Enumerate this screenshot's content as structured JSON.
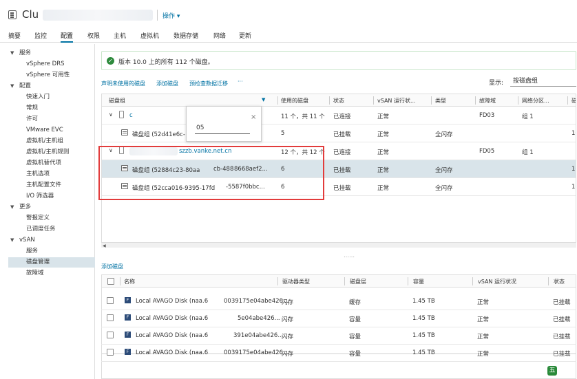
{
  "header": {
    "title": "Clu",
    "actions_label": "操作 ▾"
  },
  "tabs": [
    "摘要",
    "监控",
    "配置",
    "权限",
    "主机",
    "虚拟机",
    "数据存储",
    "网络",
    "更新"
  ],
  "sidebar": {
    "groups": [
      {
        "label": "服务",
        "items": [
          "vSphere DRS",
          "vSphere 可用性"
        ]
      },
      {
        "label": "配置",
        "items": [
          "快速入门",
          "常规",
          "许可",
          "VMware EVC",
          "虚拟机/主机组",
          "虚拟机/主机规则",
          "虚拟机替代项",
          "主机选项",
          "主机配置文件",
          "I/O 筛选器"
        ]
      },
      {
        "label": "更多",
        "items": [
          "警报定义",
          "已调度任务"
        ]
      },
      {
        "label": "vSAN",
        "items": [
          "服务",
          "磁盘管理",
          "故障域"
        ]
      }
    ],
    "selected": "磁盘管理"
  },
  "alert": {
    "text": "版本 10.0 上的所有 112 个磁盘。"
  },
  "toolbar": {
    "claim": "声明未使用的磁盘",
    "add": "添加磁盘",
    "precheck": "预检查数据迁移",
    "more": "···",
    "display_label": "显示:",
    "display_value": "按磁盘组"
  },
  "grid": {
    "columns": [
      "磁盘组",
      "使用的磁盘",
      "状态",
      "vSAN 运行状...",
      "类型",
      "故障域",
      "网络分区...",
      "磁"
    ],
    "rows": [
      {
        "name": "c",
        "used": "11 个，共 11 个",
        "status": "已连接",
        "health": "正常",
        "type": "",
        "fault": "FD03",
        "net": "组 1",
        "disk": ""
      },
      {
        "name": "磁盘组 (52d41e6c-",
        "used": "5",
        "status": "已挂载",
        "health": "正常",
        "type": "全闪存",
        "fault": "",
        "net": "",
        "disk": "10"
      },
      {
        "name": "szzb.vanke.net.cn",
        "used": "12 个，共 12 个",
        "status": "已连接",
        "health": "正常",
        "type": "",
        "fault": "FD05",
        "net": "组 1",
        "disk": ""
      },
      {
        "name": "磁盘组 (52884c23-80aa",
        "name2": "cb-488",
        "name3": "8668aef2...",
        "used": "6",
        "status": "已挂载",
        "health": "正常",
        "type": "全闪存",
        "fault": "",
        "net": "",
        "disk": "10"
      },
      {
        "name": "磁盘组 (52cca016-9395-17fd",
        "name2": "-5587f0bbc...",
        "used": "6",
        "status": "已挂载",
        "health": "正常",
        "type": "全闪存",
        "fault": "",
        "net": "",
        "disk": "10"
      }
    ]
  },
  "filter_popup": {
    "value": "05",
    "close": "×"
  },
  "add_disk_link": "添加磁盘",
  "disk_grid": {
    "columns": [
      "名称",
      "驱动器类型",
      "磁盘层",
      "容量",
      "vSAN 运行状况",
      "状态"
    ],
    "rows": [
      {
        "name": "Local AVAGO Disk (naa.6",
        "name_tail": "0039175e04abe426...",
        "drive": "闪存",
        "tier": "缓存",
        "capacity": "1.45 TB",
        "health": "正常",
        "state": "已挂载"
      },
      {
        "name": "Local AVAGO Disk (naa.6",
        "name_tail": "5e04abe426...",
        "drive": "闪存",
        "tier": "容量",
        "capacity": "1.45 TB",
        "health": "正常",
        "state": "已挂载"
      },
      {
        "name": "Local AVAGO Disk (naa.6",
        "name_tail": "391e04abe426...",
        "drive": "闪存",
        "tier": "容量",
        "capacity": "1.45 TB",
        "health": "正常",
        "state": "已挂载"
      },
      {
        "name": "Local AVAGO Disk (naa.6",
        "name_tail": "0039175e04abe426...",
        "drive": "闪存",
        "tier": "容量",
        "capacity": "1.45 TB",
        "health": "正常",
        "state": "已挂载"
      }
    ]
  },
  "corner_badge": "五"
}
